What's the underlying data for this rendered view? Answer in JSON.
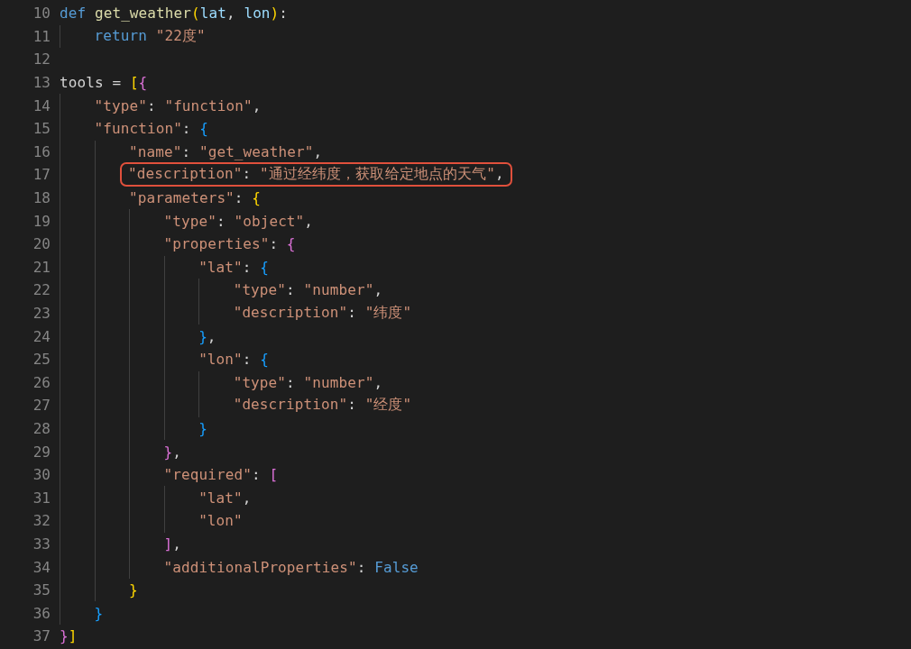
{
  "editor": {
    "lines": [
      {
        "number": "10",
        "highlighted": false,
        "tokens": [
          {
            "text": "def ",
            "kind": "keyword"
          },
          {
            "text": "get_weather",
            "kind": "func"
          },
          {
            "text": "(",
            "kind": "bracket1"
          },
          {
            "text": "lat",
            "kind": "param"
          },
          {
            "text": ", ",
            "kind": "plain"
          },
          {
            "text": "lon",
            "kind": "param"
          },
          {
            "text": ")",
            "kind": "bracket1"
          },
          {
            "text": ":",
            "kind": "plain"
          }
        ]
      },
      {
        "number": "11",
        "highlighted": false,
        "tokens": [
          {
            "text": "    return ",
            "kind": "keyword"
          },
          {
            "text": "\"22度\"",
            "kind": "string"
          }
        ]
      },
      {
        "number": "12"
      },
      {
        "number": "13",
        "highlighted": false,
        "tokens": [
          {
            "text": "tools = ",
            "kind": "plain"
          },
          {
            "text": "[",
            "kind": "bracket1"
          },
          {
            "text": "{",
            "kind": "bracket2"
          }
        ]
      },
      {
        "number": "14",
        "highlighted": false,
        "tokens": [
          {
            "text": "    \"type\"",
            "kind": "string"
          },
          {
            "text": ": ",
            "kind": "plain"
          },
          {
            "text": "\"function\"",
            "kind": "string"
          },
          {
            "text": ",",
            "kind": "plain"
          }
        ]
      },
      {
        "number": "15",
        "highlighted": false,
        "tokens": [
          {
            "text": "    \"function\"",
            "kind": "string"
          },
          {
            "text": ": ",
            "kind": "plain"
          },
          {
            "text": "{",
            "kind": "bracket3"
          }
        ]
      },
      {
        "number": "16",
        "highlighted": false,
        "tokens": [
          {
            "text": "        \"name\"",
            "kind": "string"
          },
          {
            "text": ": ",
            "kind": "plain"
          },
          {
            "text": "\"get_weather\"",
            "kind": "string"
          },
          {
            "text": ",",
            "kind": "plain"
          }
        ]
      },
      {
        "number": "17",
        "highlighted": true,
        "tokens": [
          {
            "text": "        \"description\"",
            "kind": "string"
          },
          {
            "text": ": ",
            "kind": "plain"
          },
          {
            "text": "\"通过经纬度，获取给定地点的天气\"",
            "kind": "string"
          },
          {
            "text": ",",
            "kind": "plain"
          }
        ]
      },
      {
        "number": "18",
        "highlighted": false,
        "tokens": [
          {
            "text": "        \"parameters\"",
            "kind": "string"
          },
          {
            "text": ": ",
            "kind": "plain"
          },
          {
            "text": "{",
            "kind": "bracket1"
          }
        ]
      },
      {
        "number": "19",
        "highlighted": false,
        "tokens": [
          {
            "text": "            \"type\"",
            "kind": "string"
          },
          {
            "text": ": ",
            "kind": "plain"
          },
          {
            "text": "\"object\"",
            "kind": "string"
          },
          {
            "text": ",",
            "kind": "plain"
          }
        ]
      },
      {
        "number": "20",
        "highlighted": false,
        "tokens": [
          {
            "text": "            \"properties\"",
            "kind": "string"
          },
          {
            "text": ": ",
            "kind": "plain"
          },
          {
            "text": "{",
            "kind": "bracket2"
          }
        ]
      },
      {
        "number": "21",
        "highlighted": false,
        "tokens": [
          {
            "text": "                \"lat\"",
            "kind": "string"
          },
          {
            "text": ": ",
            "kind": "plain"
          },
          {
            "text": "{",
            "kind": "bracket3"
          }
        ]
      },
      {
        "number": "22",
        "highlighted": false,
        "tokens": [
          {
            "text": "                    \"type\"",
            "kind": "string"
          },
          {
            "text": ": ",
            "kind": "plain"
          },
          {
            "text": "\"number\"",
            "kind": "string"
          },
          {
            "text": ",",
            "kind": "plain"
          }
        ]
      },
      {
        "number": "23",
        "highlighted": false,
        "tokens": [
          {
            "text": "                    \"description\"",
            "kind": "string"
          },
          {
            "text": ": ",
            "kind": "plain"
          },
          {
            "text": "\"纬度\"",
            "kind": "string"
          }
        ]
      },
      {
        "number": "24",
        "highlighted": false,
        "tokens": [
          {
            "text": "                }",
            "kind": "bracket3"
          },
          {
            "text": ",",
            "kind": "plain"
          }
        ]
      },
      {
        "number": "25",
        "highlighted": false,
        "tokens": [
          {
            "text": "                \"lon\"",
            "kind": "string"
          },
          {
            "text": ": ",
            "kind": "plain"
          },
          {
            "text": "{",
            "kind": "bracket3"
          }
        ]
      },
      {
        "number": "26",
        "highlighted": false,
        "tokens": [
          {
            "text": "                    \"type\"",
            "kind": "string"
          },
          {
            "text": ": ",
            "kind": "plain"
          },
          {
            "text": "\"number\"",
            "kind": "string"
          },
          {
            "text": ",",
            "kind": "plain"
          }
        ]
      },
      {
        "number": "27",
        "highlighted": false,
        "tokens": [
          {
            "text": "                    \"description\"",
            "kind": "string"
          },
          {
            "text": ": ",
            "kind": "plain"
          },
          {
            "text": "\"经度\"",
            "kind": "string"
          }
        ]
      },
      {
        "number": "28",
        "highlighted": false,
        "tokens": [
          {
            "text": "                }",
            "kind": "bracket3"
          }
        ]
      },
      {
        "number": "29",
        "highlighted": false,
        "tokens": [
          {
            "text": "            }",
            "kind": "bracket2"
          },
          {
            "text": ",",
            "kind": "plain"
          }
        ]
      },
      {
        "number": "30",
        "highlighted": false,
        "tokens": [
          {
            "text": "            \"required\"",
            "kind": "string"
          },
          {
            "text": ": ",
            "kind": "plain"
          },
          {
            "text": "[",
            "kind": "bracket2"
          }
        ]
      },
      {
        "number": "31",
        "highlighted": false,
        "tokens": [
          {
            "text": "                \"lat\"",
            "kind": "string"
          },
          {
            "text": ",",
            "kind": "plain"
          }
        ]
      },
      {
        "number": "32",
        "highlighted": false,
        "tokens": [
          {
            "text": "                \"lon\"",
            "kind": "string"
          }
        ]
      },
      {
        "number": "33",
        "highlighted": false,
        "tokens": [
          {
            "text": "            ]",
            "kind": "bracket2"
          },
          {
            "text": ",",
            "kind": "plain"
          }
        ]
      },
      {
        "number": "34",
        "highlighted": false,
        "tokens": [
          {
            "text": "            \"additionalProperties\"",
            "kind": "string"
          },
          {
            "text": ": ",
            "kind": "plain"
          },
          {
            "text": "False",
            "kind": "constant"
          }
        ]
      },
      {
        "number": "35",
        "highlighted": false,
        "tokens": [
          {
            "text": "        }",
            "kind": "bracket1"
          }
        ]
      },
      {
        "number": "36",
        "highlighted": false,
        "tokens": [
          {
            "text": "    }",
            "kind": "bracket3"
          }
        ]
      },
      {
        "number": "37",
        "highlighted": false,
        "tokens": [
          {
            "text": "}",
            "kind": "bracket2"
          },
          {
            "text": "]",
            "kind": "bracket1"
          }
        ]
      }
    ]
  }
}
